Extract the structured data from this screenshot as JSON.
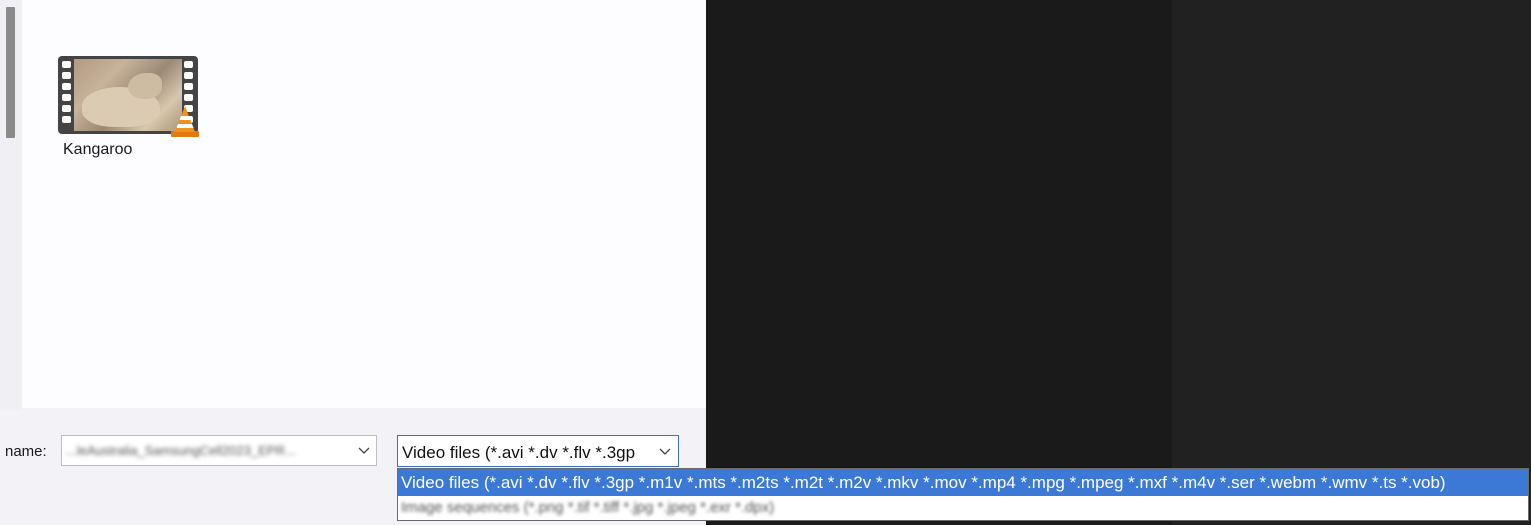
{
  "file_list": {
    "items": [
      {
        "name": "Kangaroo",
        "type": "video",
        "icon": "video-file-thumbnail-icon"
      }
    ]
  },
  "footer": {
    "name_label": "name:",
    "name_value": "...leAustralia_SamsungCell2023_EPR..."
  },
  "filter": {
    "selected": "Video files (*.avi *.dv *.flv *.3gp",
    "options": [
      "Video files (*.avi *.dv *.flv *.3gp *.m1v *.mts *.m2ts *.m2t *.m2v *.mkv *.mov *.mp4 *.mpg *.mpeg *.mxf *.m4v *.ser *.webm *.wmv *.ts *.vob)",
      "Image sequences (*.png *.tif *.tiff *.jpg *.jpeg *.exr *.dpx)"
    ]
  },
  "colors": {
    "accent": "#3c79d6",
    "dark_panel": "#1a1a1a",
    "dialog_bg": "#f3f2f7"
  }
}
